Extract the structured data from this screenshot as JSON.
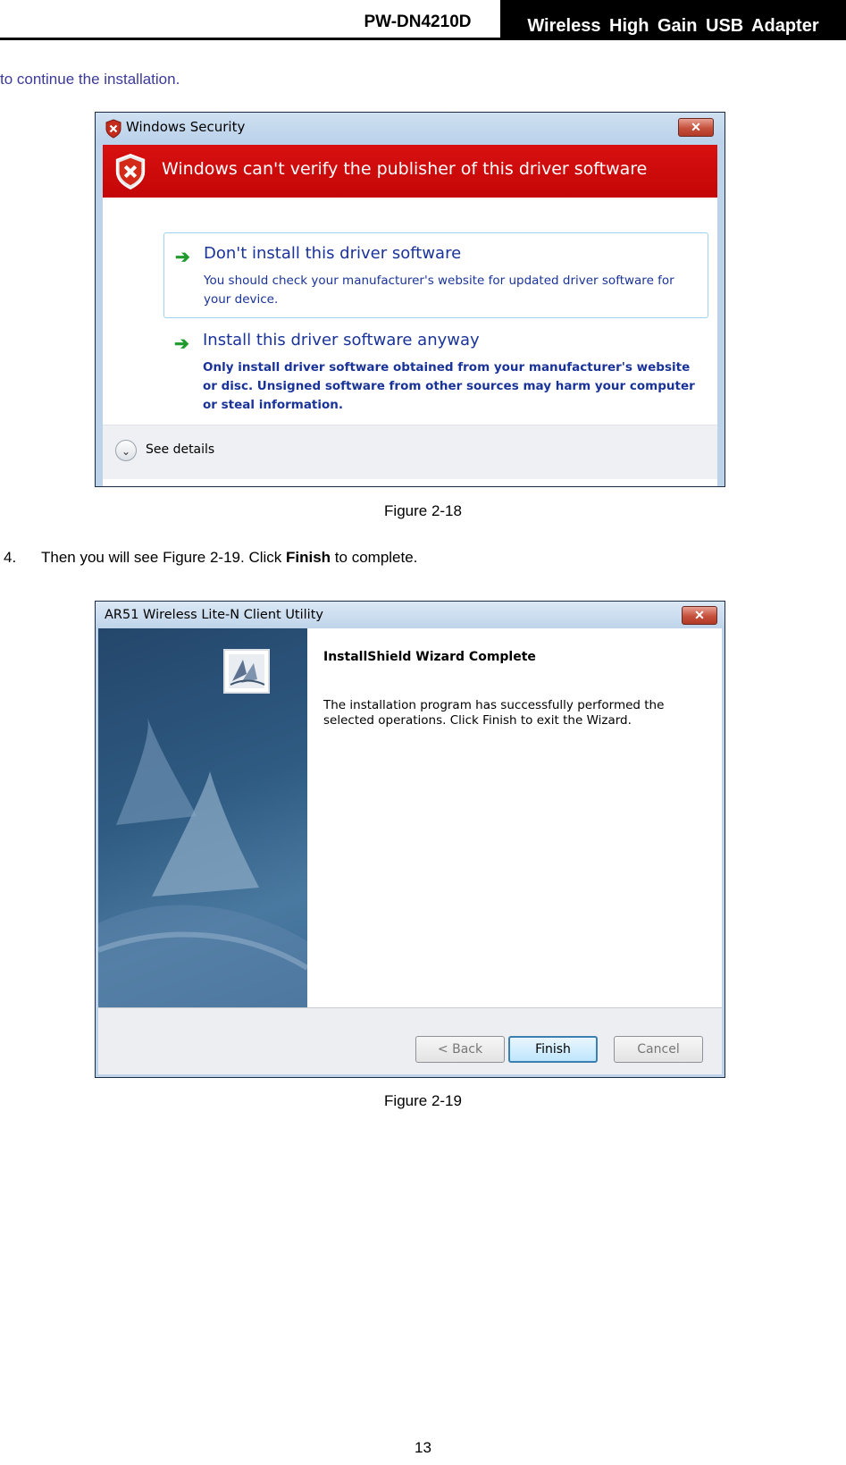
{
  "header": {
    "model": "PW-DN4210D",
    "product": "Wireless  High  Gain  USB  Adapter"
  },
  "intro": "to continue the installation.",
  "figure18": {
    "window_title": "Windows Security",
    "banner": "Windows can't verify the publisher of this driver software",
    "option1_title": "Don't install this driver software",
    "option1_desc": "You should check your manufacturer's website for updated driver software for your device.",
    "option2_title": "Install this driver software anyway",
    "option2_desc": "Only install driver software obtained from your manufacturer's website or disc. Unsigned software from other sources may harm your computer or steal information.",
    "details": "See details",
    "caption": "Figure 2-18"
  },
  "step4": {
    "number": "4.",
    "text_before": "Then you will see Figure 2-19. Click ",
    "bold": "Finish",
    "text_after": " to complete."
  },
  "figure19": {
    "window_title": "AR51 Wireless Lite-N Client Utility",
    "heading": "InstallShield Wizard Complete",
    "message": "The installation program has successfully performed the selected operations.  Click Finish to exit the Wizard.",
    "back_label": "< Back",
    "finish_label": "Finish",
    "cancel_label": "Cancel",
    "caption": "Figure 2-19"
  },
  "page_number": "13",
  "icons": {
    "close": "close-icon",
    "shield": "shield-x-icon",
    "arrow": "green-arrow-icon",
    "chevron": "chevron-down-icon"
  }
}
